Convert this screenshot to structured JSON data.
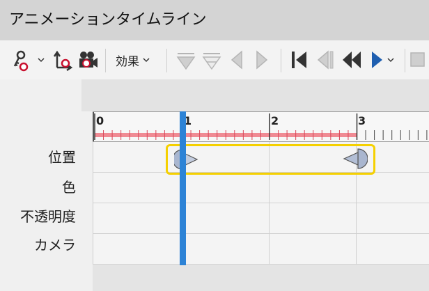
{
  "window": {
    "title": "アニメーションタイムライン"
  },
  "toolbar": {
    "effect_label": "効果",
    "icons": [
      "key-person-icon",
      "chevron-down-icon",
      "motion-path-icon",
      "camera-icon",
      "add-keyframe-icon",
      "remove-keyframe-icon",
      "previous-keyframe-icon",
      "next-keyframe-icon",
      "go-to-start-icon",
      "step-back-icon",
      "rewind-icon",
      "play-icon",
      "chevron-down-icon",
      "stop-icon"
    ]
  },
  "ruler": {
    "labels": [
      "0",
      "1",
      "2",
      "3"
    ],
    "played_color": "#f08a93"
  },
  "tracks": {
    "labels": [
      "位置",
      "色",
      "不透明度",
      "カメラ"
    ]
  },
  "playhead": {
    "time": 1.0,
    "color": "#2d83d6"
  },
  "selection": {
    "track": "位置",
    "color": "#f5d000"
  },
  "keyframes": [
    {
      "track": "位置",
      "time": 1.0
    },
    {
      "track": "位置",
      "time": 3.0
    }
  ]
}
